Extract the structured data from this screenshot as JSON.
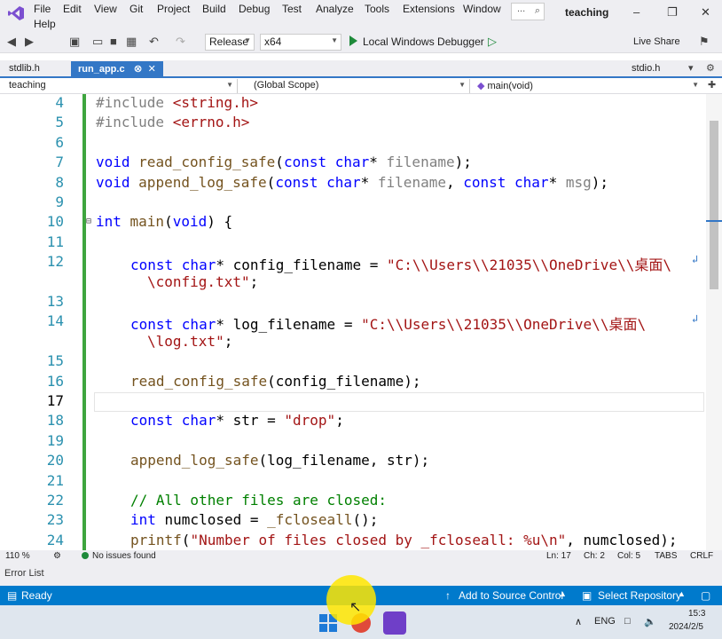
{
  "menu": {
    "items": [
      "File",
      "Edit",
      "View",
      "Git",
      "Project",
      "Build",
      "Debug",
      "Test",
      "Analyze",
      "Tools",
      "Extensions",
      "Window",
      "Help"
    ],
    "search_label": "...",
    "solution_name": "teaching"
  },
  "toolbar": {
    "configuration": "Release",
    "platform": "x64",
    "debugger_label": "Local Windows Debugger",
    "live_share": "Live Share"
  },
  "tabs": [
    {
      "label": "stdlib.h",
      "active": false
    },
    {
      "label": "run_app.c",
      "active": true
    },
    {
      "label": "stdio.h",
      "active": false
    }
  ],
  "navbar": {
    "project": "teaching",
    "scope": "(Global Scope)",
    "member": "main(void)"
  },
  "code": {
    "lines": [
      {
        "n": "4",
        "y": 0
      },
      {
        "n": "5"
      },
      {
        "n": "6"
      },
      {
        "n": "7"
      },
      {
        "n": "8"
      },
      {
        "n": "9"
      },
      {
        "n": "10"
      },
      {
        "n": "11"
      },
      {
        "n": "12"
      },
      {
        "n": "13"
      },
      {
        "n": "14"
      },
      {
        "n": "15"
      },
      {
        "n": "16"
      },
      {
        "n": "17"
      },
      {
        "n": "18"
      },
      {
        "n": "19"
      },
      {
        "n": "20"
      },
      {
        "n": "21"
      },
      {
        "n": "22"
      },
      {
        "n": "23"
      },
      {
        "n": "24"
      }
    ],
    "t4a": "#include ",
    "t4b": "<string.h>",
    "t5a": "#include ",
    "t5b": "<errno.h>",
    "t7a": "void ",
    "t7b": "read_config_safe",
    "t7c": "(",
    "t7d": "const ",
    "t7e": "char",
    "t7f": "* ",
    "t7g": "filename",
    "t7h": ");",
    "t8a": "void ",
    "t8b": "append_log_safe",
    "t8c": "(",
    "t8d": "const ",
    "t8e": "char",
    "t8f": "* ",
    "t8g": "filename",
    "t8h": ", ",
    "t8i": "const ",
    "t8j": "char",
    "t8k": "* ",
    "t8l": "msg",
    "t8m": ");",
    "t10a": "int ",
    "t10b": "main",
    "t10c": "(",
    "t10d": "void",
    "t10e": ") {",
    "t12a": "const ",
    "t12b": "char",
    "t12c": "* config_filename = ",
    "t12d": "\"C:\\\\Users\\\\21035\\\\OneDrive\\\\桌面\\",
    "t12e": "\\config.txt\"",
    "t12f": ";",
    "t14a": "const ",
    "t14b": "char",
    "t14c": "* log_filename = ",
    "t14d": "\"C:\\\\Users\\\\21035\\\\OneDrive\\\\桌面\\",
    "t14e": "\\log.txt\"",
    "t14f": ";",
    "t16a": "read_config_safe",
    "t16b": "(config_filename);",
    "t18a": "const ",
    "t18b": "char",
    "t18c": "* str = ",
    "t18d": "\"drop\"",
    "t18e": ";",
    "t20a": "append_log_safe",
    "t20b": "(log_filename, str);",
    "t22a": "// All other files are closed:",
    "t23a": "int ",
    "t23b": "numclosed = ",
    "t23c": "_fcloseall",
    "t23d": "();",
    "t24a": "printf",
    "t24b": "(",
    "t24c": "\"Number of files closed by _fcloseall: %u\\n\"",
    "t24d": ", numclosed);"
  },
  "editor_status": {
    "zoom": "110 %",
    "issues": "No issues found",
    "ln": "Ln: 17",
    "ch": "Ch: 2",
    "col": "Col: 5",
    "tabs": "TABS",
    "eol": "CRLF"
  },
  "error_list": "Error List",
  "statusbar": {
    "ready": "Ready",
    "source_control": "Add to Source Control",
    "repository": "Select Repository"
  },
  "taskbar": {
    "lang": "ENG",
    "time": "15:3",
    "date": "2024/2/5"
  }
}
